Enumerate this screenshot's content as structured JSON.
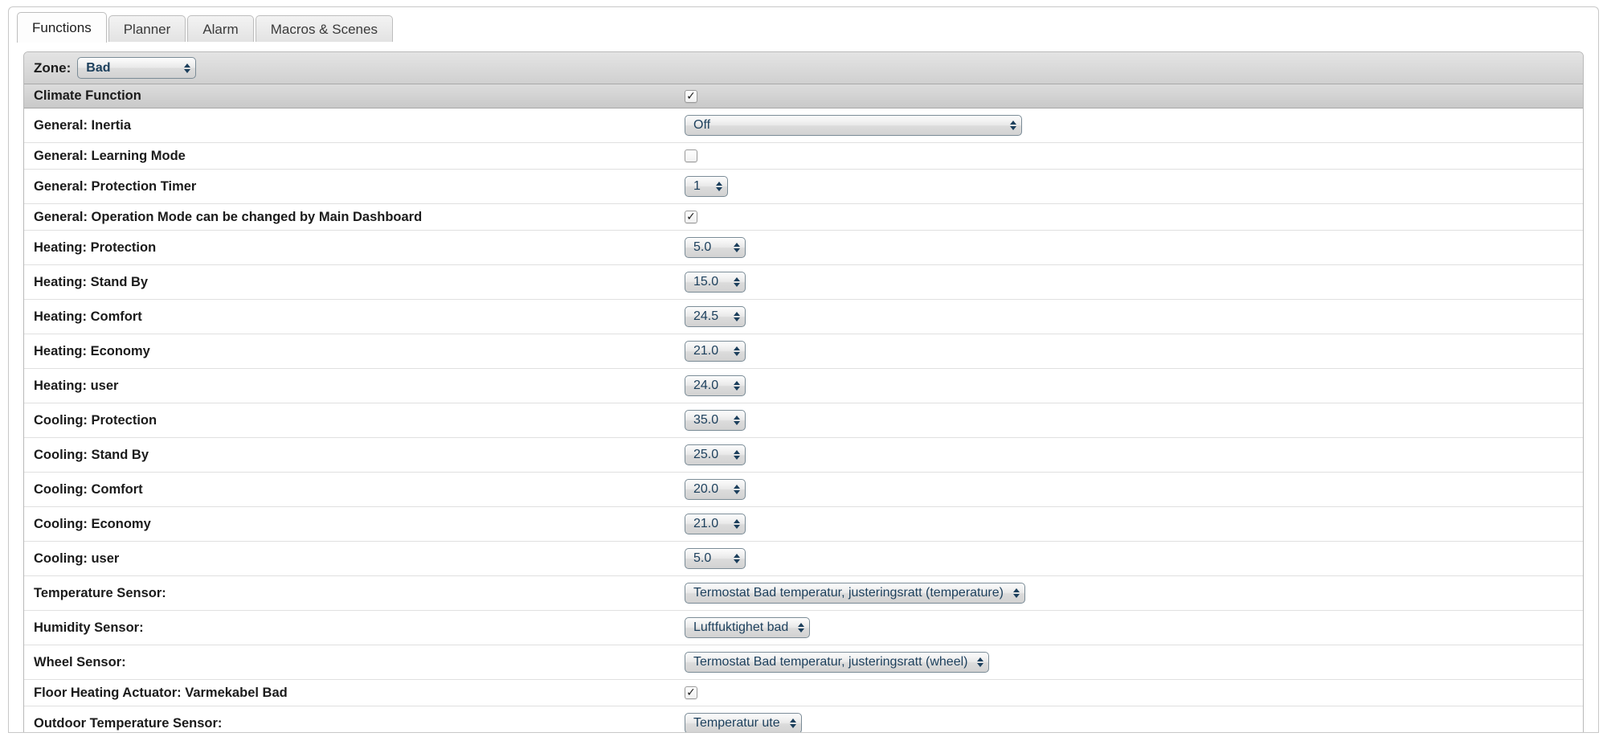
{
  "tabs": [
    {
      "label": "Functions",
      "active": true
    },
    {
      "label": "Planner",
      "active": false
    },
    {
      "label": "Alarm",
      "active": false
    },
    {
      "label": "Macros & Scenes",
      "active": false
    }
  ],
  "zone": {
    "label": "Zone:",
    "value": "Bad"
  },
  "section": {
    "title": "Climate Function",
    "enabled_checked": true
  },
  "rows": [
    {
      "label": "General: Inertia",
      "type": "select-wide",
      "value": "Off"
    },
    {
      "label": "General: Learning Mode",
      "type": "checkbox",
      "checked": false
    },
    {
      "label": "General: Protection Timer",
      "type": "stepper-narrow",
      "value": "1"
    },
    {
      "label": "General: Operation Mode can be changed by Main Dashboard",
      "type": "checkbox",
      "checked": true
    },
    {
      "label": "Heating: Protection",
      "type": "stepper",
      "value": "5.0"
    },
    {
      "label": "Heating: Stand By",
      "type": "stepper",
      "value": "15.0"
    },
    {
      "label": "Heating: Comfort",
      "type": "stepper",
      "value": "24.5"
    },
    {
      "label": "Heating: Economy",
      "type": "stepper",
      "value": "21.0"
    },
    {
      "label": "Heating: user",
      "type": "stepper",
      "value": "24.0"
    },
    {
      "label": "Cooling: Protection",
      "type": "stepper",
      "value": "35.0"
    },
    {
      "label": "Cooling: Stand By",
      "type": "stepper",
      "value": "25.0"
    },
    {
      "label": "Cooling: Comfort",
      "type": "stepper",
      "value": "20.0"
    },
    {
      "label": "Cooling: Economy",
      "type": "stepper",
      "value": "21.0"
    },
    {
      "label": "Cooling: user",
      "type": "stepper",
      "value": "5.0"
    },
    {
      "label": "Temperature Sensor:",
      "type": "select-auto",
      "value": "Termostat Bad temperatur, justeringsratt (temperature)"
    },
    {
      "label": "Humidity Sensor:",
      "type": "select-auto",
      "value": "Luftfuktighet bad"
    },
    {
      "label": "Wheel Sensor:",
      "type": "select-auto",
      "value": "Termostat Bad temperatur, justeringsratt (wheel)"
    },
    {
      "label": "Floor Heating Actuator: Varmekabel Bad",
      "type": "checkbox",
      "checked": true
    },
    {
      "label": "Outdoor Temperature Sensor:",
      "type": "select-auto",
      "value": "Temperatur ute"
    }
  ],
  "icons": {
    "stepper_arrows": "up-down-arrows-icon",
    "checkmark": "check-icon"
  },
  "colors": {
    "select_text": "#1c3f5c",
    "section_bg": "#d2d2d2",
    "label_text": "#1b1b1b"
  }
}
